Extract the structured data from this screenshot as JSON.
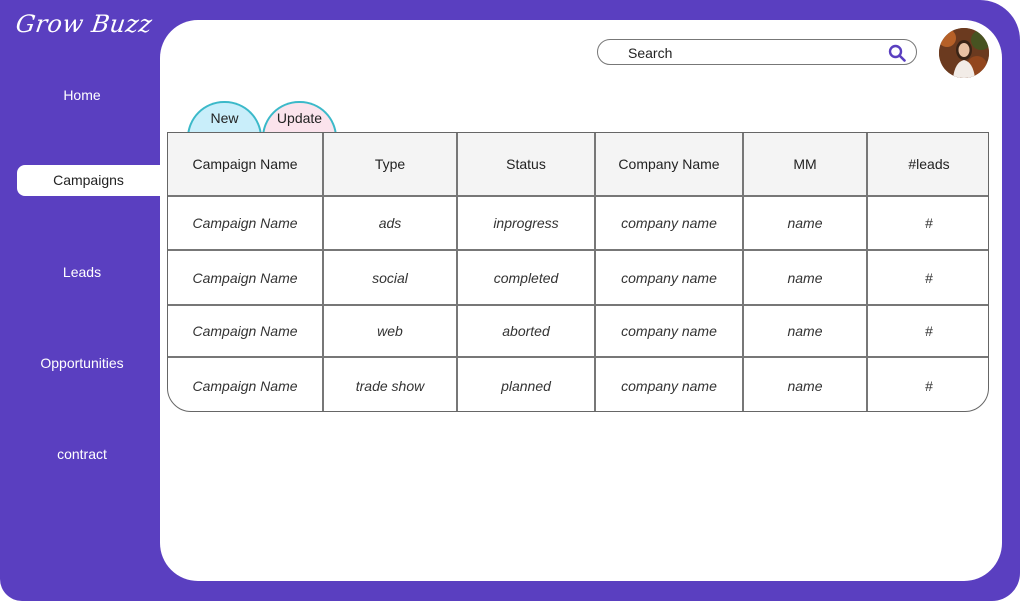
{
  "app": {
    "logo": "Grow Buzz"
  },
  "colors": {
    "brand": "#5a3fc0",
    "tab_new": "#c9eefa",
    "tab_update": "#fbe3ec",
    "tab_border": "#3bb9c9"
  },
  "nav": {
    "items": [
      {
        "label": "Home",
        "active": false
      },
      {
        "label": "Campaigns",
        "active": true
      },
      {
        "label": "Leads",
        "active": false
      },
      {
        "label": "Opportunities",
        "active": false
      },
      {
        "label": "contract",
        "active": false
      }
    ]
  },
  "search": {
    "placeholder": "Search",
    "icon": "search-icon"
  },
  "profile": {
    "icon": "avatar"
  },
  "tabs": [
    {
      "label": "New"
    },
    {
      "label": "Update"
    }
  ],
  "table": {
    "headers": [
      "Campaign Name",
      "Type",
      "Status",
      "Company Name",
      "MM",
      "#leads"
    ],
    "rows": [
      [
        "Campaign Name",
        "ads",
        "inprogress",
        "company name",
        "name",
        "#"
      ],
      [
        "Campaign Name",
        "social",
        "completed",
        "company name",
        "name",
        "#"
      ],
      [
        "Campaign Name",
        "web",
        "aborted",
        "company name",
        "name",
        "#"
      ],
      [
        "Campaign Name",
        "trade show",
        "planned",
        "company name",
        "name",
        "#"
      ]
    ]
  }
}
